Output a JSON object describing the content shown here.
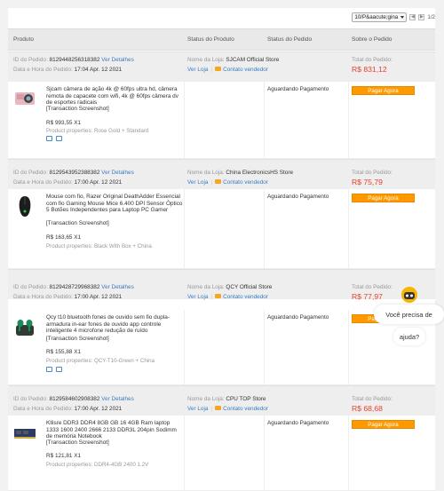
{
  "pager": {
    "select_value": "10/P&aacute;gina",
    "page_indicator": "1/2"
  },
  "columns": {
    "product": "Produto",
    "product_status": "Status do Produto",
    "order_status": "Status do Pedido",
    "about_order": "Sobre o Pedido"
  },
  "labels": {
    "order_id": "ID do Pedido:",
    "date_time": "Data e Hora do Pedido:",
    "details": "Ver Detalhes",
    "store_name": "Nome da Loja:",
    "view_store": "Ver Loja",
    "contact_seller": "Contato vendedor",
    "order_total": "Total do Pedido:",
    "pay_now": "Pagar Agora",
    "transaction_screenshot": "[Transaction Screenshot]",
    "product_properties": "Product properties:"
  },
  "orders": [
    {
      "id": "8129448256318382",
      "date": "17:04 Apr. 12 2021",
      "store": "SJCAM Official Store",
      "total": "R$ 831,12",
      "description": "Sjcam câmera de ação 4k @ 60fps ultra hd, câmera remota de capacete com wifi, 4k @ 60fps câmera dv de esportes radicais",
      "price": "R$ 993,55 X1",
      "properties": "Rose Gold + Standard",
      "status": "Aguardando Pagamento",
      "thumb": "camera-thumbnail"
    },
    {
      "id": "8129543952388382",
      "date": "17:00 Apr. 12 2021",
      "store": "China ElectronicsHS Store",
      "total": "R$ 75,79",
      "description": "Mouse com fio, Razer Original DeathAdder Essencial com fio Gaming Mouse Mice 6.400 DPI Sensor Óptico 5 Botões Independentes para Laptop PC Gamer",
      "price": "R$ 163,65 X1",
      "properties": "Black With Box + China",
      "status": "Aguardando Pagamento",
      "thumb": "mouse-thumbnail"
    },
    {
      "id": "8129428729968382",
      "date": "17:00 Apr. 12 2021",
      "store": "QCY Official Store",
      "total": "R$ 77,97",
      "description": "Qcy t10 bluetooth fones de ouvido sem fio dupla-armadura in-ear fones de ouvido app controle inteligente 4 microfone redução de ruído",
      "price": "R$ 155,88 X1",
      "properties": "QCY-T10-Green + China",
      "status": "Aguardando Pagamento",
      "thumb": "earbuds-thumbnail"
    },
    {
      "id": "8129584602908382",
      "date": "17:00 Apr. 12 2021",
      "store": "CPU TOP Store",
      "total": "R$ 68,68",
      "description": "Kllisre DDR3 DDR4 8GB GB 16 4GB Ram laptop 1333 1600 2400 2666 2133 DDR3L 204pin Sodimm de memória Notebook",
      "price": "R$ 121,81 X1",
      "properties": "DDR4-4GB 2400 1.2V",
      "status": "Aguardando Pagamento",
      "thumb": "ram-thumbnail"
    }
  ],
  "chat": {
    "line1": "Você precisa de",
    "line2": "ajuda?"
  },
  "colors": {
    "accent_orange": "#ff9900",
    "link_blue": "#3a7cc3",
    "total_red": "#e8412b"
  }
}
